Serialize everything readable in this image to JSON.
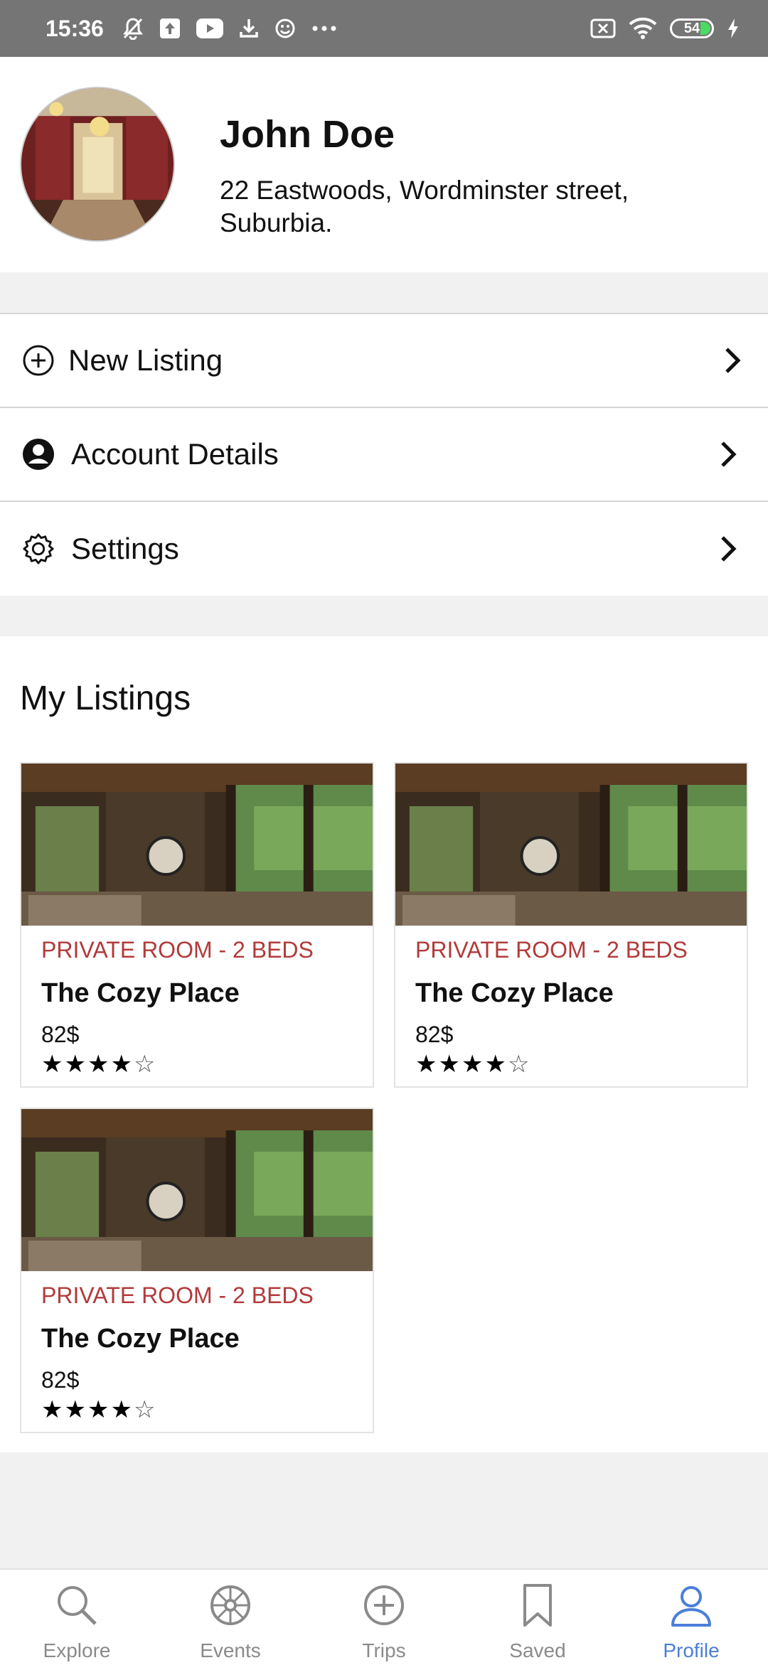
{
  "status_bar": {
    "time": "15:36",
    "battery": "54",
    "icons": [
      "mute-bell-icon",
      "upload-icon",
      "youtube-icon",
      "download-icon",
      "smiley-icon",
      "more-dots-icon",
      "sim-x-icon",
      "wifi-icon",
      "battery-icon",
      "charging-icon"
    ]
  },
  "profile": {
    "name": "John Doe",
    "address": "22 Eastwoods, Wordminster street, Suburbia."
  },
  "menu": [
    {
      "label": "New Listing",
      "icon": "plus-circle-icon"
    },
    {
      "label": "Account Details",
      "icon": "account-circle-icon"
    },
    {
      "label": "Settings",
      "icon": "gear-icon"
    }
  ],
  "listings": {
    "heading": "My Listings",
    "items": [
      {
        "type": "PRIVATE ROOM - 2 BEDS",
        "title": "The Cozy Place",
        "price": "82$",
        "rating": 4,
        "max_rating": 5
      },
      {
        "type": "PRIVATE ROOM - 2 BEDS",
        "title": "The Cozy Place",
        "price": "82$",
        "rating": 4,
        "max_rating": 5
      },
      {
        "type": "PRIVATE ROOM - 2 BEDS",
        "title": "The Cozy Place",
        "price": "82$",
        "rating": 4,
        "max_rating": 5
      }
    ]
  },
  "colors": {
    "accent": "#4a7fd8",
    "listing_type": "#b23a3a",
    "status_bar": "#757575"
  },
  "bottom_nav": [
    {
      "label": "Explore",
      "icon": "search-icon",
      "active": false
    },
    {
      "label": "Events",
      "icon": "wheel-icon",
      "active": false
    },
    {
      "label": "Trips",
      "icon": "plus-circle-icon",
      "active": false
    },
    {
      "label": "Saved",
      "icon": "bookmark-icon",
      "active": false
    },
    {
      "label": "Profile",
      "icon": "person-icon",
      "active": true
    }
  ]
}
